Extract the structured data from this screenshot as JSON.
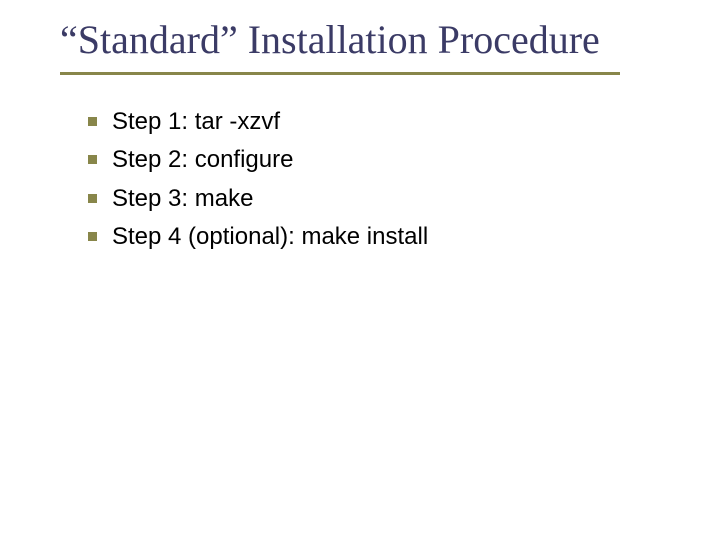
{
  "title": "“Standard” Installation Procedure",
  "steps": [
    {
      "text": "Step 1: tar -xzvf"
    },
    {
      "text": "Step 2: configure"
    },
    {
      "text": "Step 3: make"
    },
    {
      "text": "Step 4 (optional): make install"
    }
  ]
}
